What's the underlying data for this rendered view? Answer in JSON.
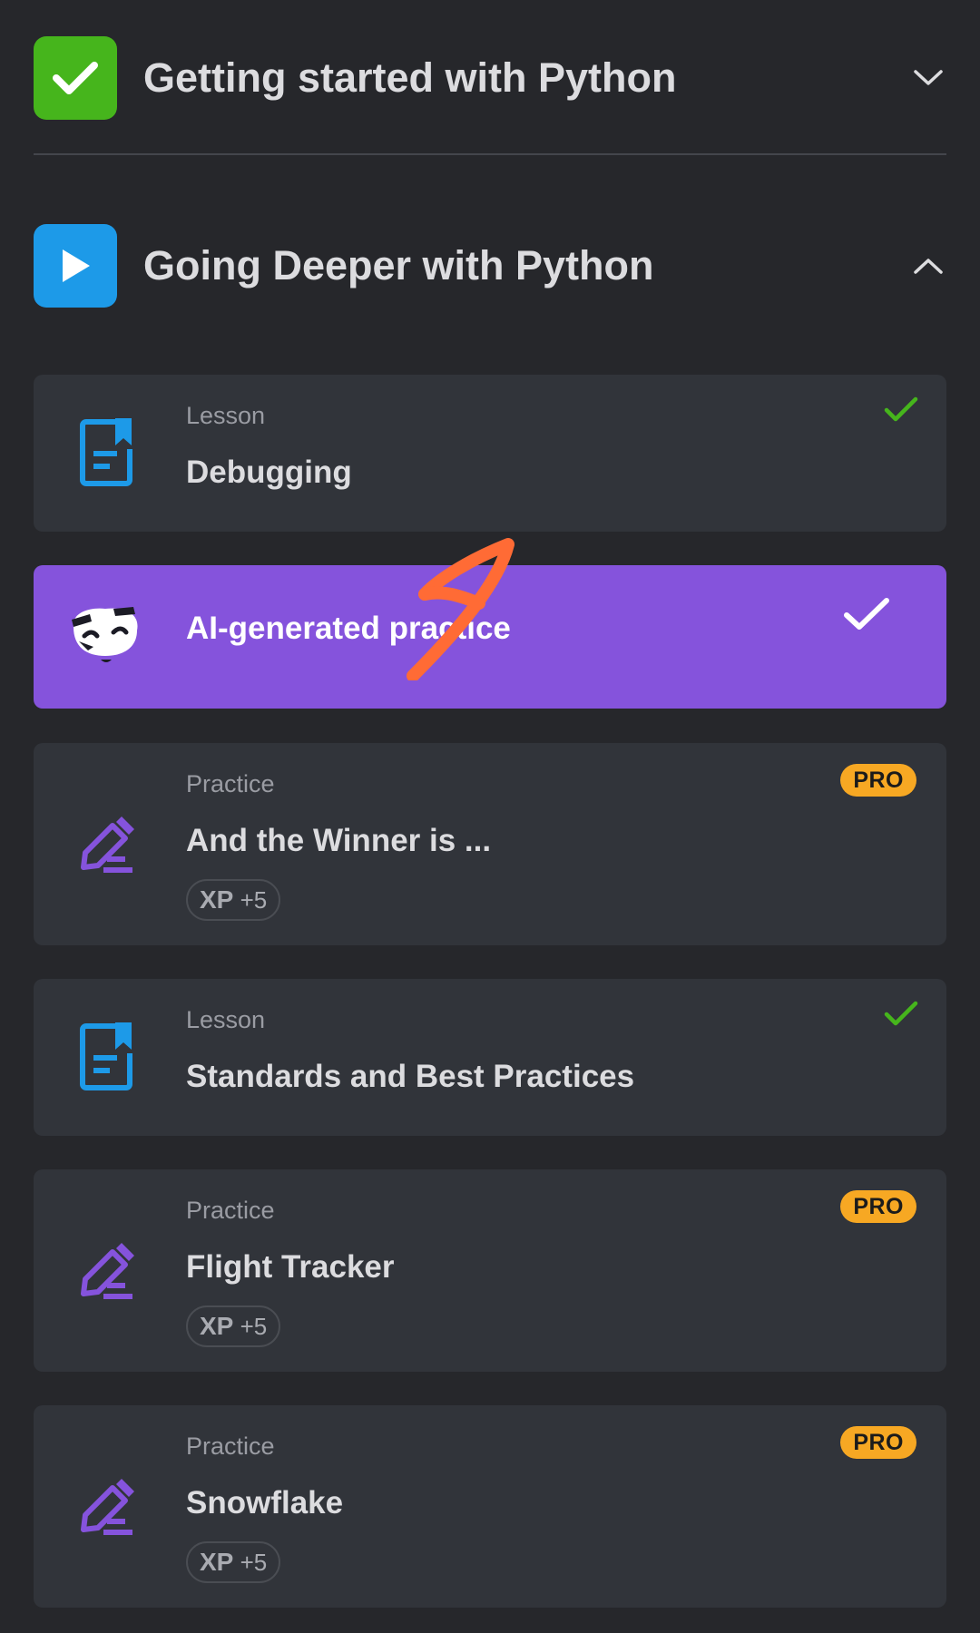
{
  "modules": [
    {
      "title": "Getting started with Python",
      "state": "completed",
      "icon": "check-icon",
      "chevron": "chevron-down-icon"
    },
    {
      "title": "Going Deeper with Python",
      "state": "in-progress",
      "icon": "play-icon",
      "chevron": "chevron-up-icon"
    }
  ],
  "items": [
    {
      "kind": "Lesson",
      "title": "Debugging",
      "icon": "lesson-icon",
      "completed": true
    },
    {
      "title": "AI-generated practice",
      "icon": "ai-mascot-icon",
      "completed": true
    },
    {
      "kind": "Practice",
      "title": "And the Winner is ...",
      "icon": "practice-pencil-icon",
      "badge": "PRO",
      "xp_label": "XP",
      "xp_value": "+5"
    },
    {
      "kind": "Lesson",
      "title": "Standards and Best Practices",
      "icon": "lesson-icon",
      "completed": true
    },
    {
      "kind": "Practice",
      "title": "Flight Tracker",
      "icon": "practice-pencil-icon",
      "badge": "PRO",
      "xp_label": "XP",
      "xp_value": "+5"
    },
    {
      "kind": "Practice",
      "title": "Snowflake",
      "icon": "practice-pencil-icon",
      "badge": "PRO",
      "xp_label": "XP",
      "xp_value": "+5"
    }
  ],
  "colors": {
    "background": "#26272b",
    "card": "#31343a",
    "ai_card": "#8553dc",
    "completed_green": "#46b51c",
    "play_blue": "#1d9ae8",
    "pro_orange": "#f7a823",
    "lesson_blue": "#1d9ae8",
    "practice_purple": "#8553dc",
    "annotation_orange": "#ff6b35"
  }
}
